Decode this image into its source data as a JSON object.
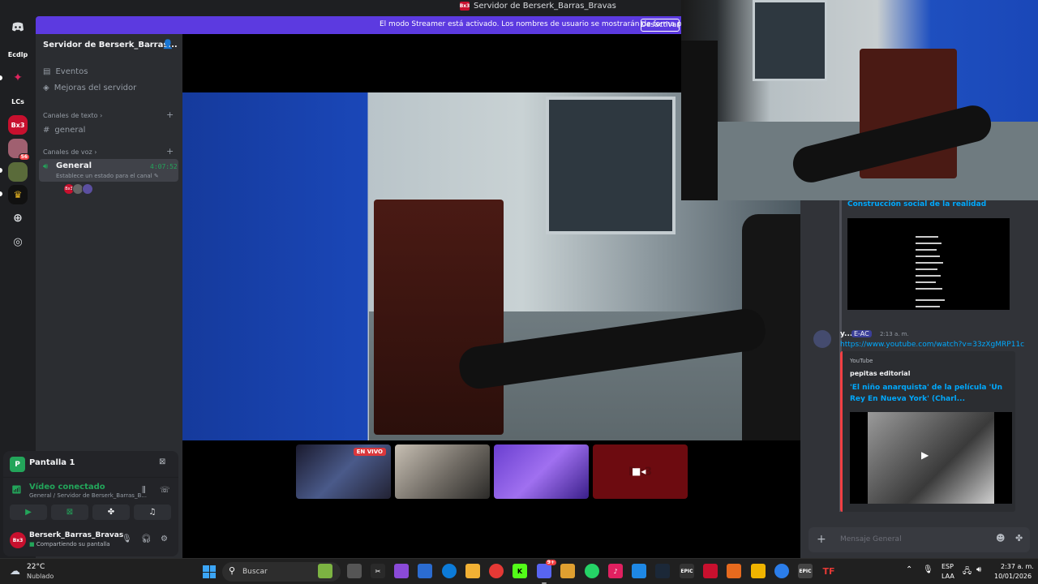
{
  "window": {
    "title": "Servidor de Berserk_Barras_Bravas",
    "logo_text": "Bx3"
  },
  "banner": {
    "message": "El modo Streamer está activado. Los nombres de usuario se mostrarán de forma parcial.",
    "button": "Desactivar"
  },
  "rail": {
    "items": [
      {
        "label": "Ecdlp"
      },
      {
        "label": "LCs"
      },
      {
        "label": "Bx3"
      },
      {
        "badge": "56"
      }
    ]
  },
  "server": {
    "name": "Servidor de Berserk_Barras...",
    "links": [
      {
        "label": "Eventos"
      },
      {
        "label": "Mejoras del servidor"
      }
    ],
    "text_category": "Canales de texto",
    "text_channel": "general",
    "voice_category": "Canales de voz",
    "voice_channel": {
      "name": "General",
      "timer": "4:07:52",
      "status_placeholder": "Establece un estado para el canal",
      "participants": [
        "Bx3"
      ]
    }
  },
  "panel": {
    "screen_label": "Pantalla 1",
    "screen_icon_text": "P",
    "voice_status": "Vídeo conectado",
    "voice_location": "General / Servidor de Berserk_Barras_B...",
    "user_name": "Berserk_Barras_Bravas",
    "user_status": "Compartiendo su pantalla",
    "avatar_text": "Bx3"
  },
  "stage": {
    "thumbnails": [
      {
        "live_label": "EN VIVO"
      },
      {},
      {},
      {
        "label": "Bx3"
      }
    ]
  },
  "chat": {
    "prev_embed_title": "Construcción social de la realidad",
    "message": {
      "author": "y...",
      "tag": "E-AC",
      "time": "2:13 a. m.",
      "url": "https://www.youtube.com/watch?v=33zXgMRP11c",
      "embed": {
        "provider": "YouTube",
        "channel": "pepitas editorial",
        "title": "'El niño anarquista' de la película 'Un Rey En Nueva York' (Charl..."
      }
    },
    "input_placeholder": "Mensaje General"
  },
  "taskbar": {
    "temperature": "22°C",
    "condition": "Nublado",
    "search_placeholder": "Buscar",
    "notif_badge": "9+",
    "language": "ESP",
    "layout": "LAA",
    "clock": "2:37 a. m.",
    "date": "10/01/2026"
  },
  "colors": {
    "accent": "#5c3ae0",
    "online": "#23a55a",
    "link": "#00a8fc",
    "danger": "#da373c",
    "brand_red": "#c8102e"
  }
}
